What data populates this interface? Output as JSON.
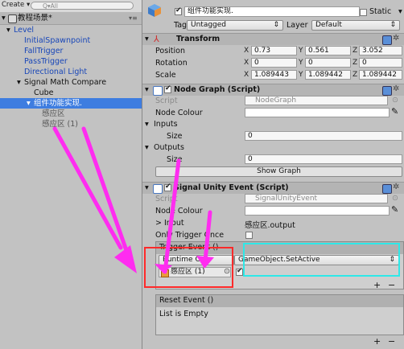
{
  "hierarchy": {
    "create_label": "Create ▾",
    "search_placeholder": "Q▾All",
    "scene_name": "教程场景*",
    "menu_glyph": "▾≡",
    "items": [
      {
        "label": "Level",
        "expanded": true
      },
      {
        "label": "InitialSpawnpoint"
      },
      {
        "label": "FallTrigger"
      },
      {
        "label": "PassTrigger"
      },
      {
        "label": "Directional Light"
      },
      {
        "label": "Signal Math Compare",
        "expanded": true
      },
      {
        "label": "Cube"
      },
      {
        "label": "组件功能实现.",
        "selected": true
      },
      {
        "label": "感应区"
      },
      {
        "label": "感应区 (1)"
      }
    ]
  },
  "inspector": {
    "object_name": "组件功能实现.",
    "static_label": "Static",
    "tag_label": "Tag",
    "tag_value": "Untagged",
    "layer_label": "Layer",
    "layer_value": "Default",
    "transform": {
      "title": "Transform",
      "position_label": "Position",
      "rotation_label": "Rotation",
      "scale_label": "Scale",
      "position": {
        "x": "0.73",
        "y": "0.561",
        "z": "3.052"
      },
      "rotation": {
        "x": "0",
        "y": "0",
        "z": "0"
      },
      "scale": {
        "x": "1.089443",
        "y": "1.089442",
        "z": "1.089442"
      }
    },
    "node_graph": {
      "title": "Node Graph (Script)",
      "script_label": "Script",
      "script_value": "NodeGraph",
      "node_colour_label": "Node Colour",
      "inputs_label": "Inputs",
      "inputs_size_label": "Size",
      "inputs_size": "0",
      "outputs_label": "Outputs",
      "outputs_size_label": "Size",
      "outputs_size": "0",
      "show_graph_label": "Show Graph"
    },
    "signal_unity_event": {
      "title": "Signal Unity Event (Script)",
      "script_label": "Script",
      "script_value": "SignalUnityEvent",
      "node_colour_label": "Node Colour",
      "input_label": "> Input",
      "input_value": "感应区.output",
      "only_trigger_label": "Only Trigger Once",
      "trigger_event_label": "Trigger Event ()",
      "runtime_value": "Runtime On",
      "function_value": "GameObject.SetActive",
      "target_object": "感应区 (1)",
      "reset_event_label": "Reset Event ()",
      "list_empty_label": "List is Empty",
      "plus_label": "+",
      "minus_label": "−"
    }
  },
  "colors": {
    "annotation_magenta": "#ff2cf0",
    "highlight_red": "#ff2a2a",
    "highlight_cyan": "#2ee8e8"
  }
}
